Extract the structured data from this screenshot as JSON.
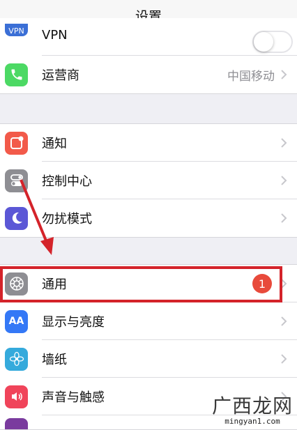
{
  "nav": {
    "title": "设置"
  },
  "group1": {
    "vpn": {
      "icon_text": "VPN",
      "label": "VPN",
      "toggle_on": false
    },
    "carrier": {
      "label": "运营商",
      "detail": "中国移动"
    }
  },
  "group2": {
    "items": [
      {
        "label": "通知",
        "icon": "notifications-icon",
        "color": "#f25a4a"
      },
      {
        "label": "控制中心",
        "icon": "control-center-icon",
        "color": "#8e8e93"
      },
      {
        "label": "勿扰模式",
        "icon": "moon-icon",
        "color": "#5b57d6"
      }
    ]
  },
  "group3": {
    "items": [
      {
        "label": "通用",
        "icon": "gear-icon",
        "color": "#8e8e93",
        "badge": "1"
      },
      {
        "label": "显示与亮度",
        "icon": "display-icon",
        "color": "#3478f6",
        "icon_text": "AA"
      },
      {
        "label": "墙纸",
        "icon": "wallpaper-icon",
        "color": "#35aadc"
      },
      {
        "label": "声音与触感",
        "icon": "sound-icon",
        "color": "#f0445a"
      }
    ]
  },
  "annotation": {
    "highlight_color": "#d4232a"
  },
  "watermark": {
    "text_cn": "广西龙网",
    "text_en": "mingyan1.com"
  }
}
